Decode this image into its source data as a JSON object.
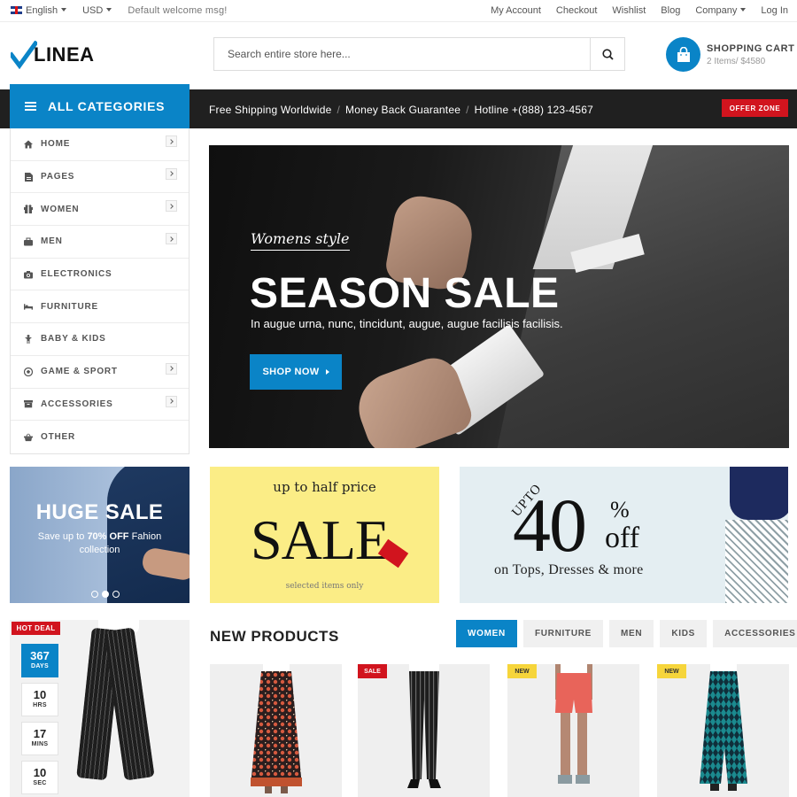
{
  "topbar": {
    "language": "English",
    "currency": "USD",
    "welcome": "Default welcome msg!",
    "links": [
      "My Account",
      "Checkout",
      "Wishlist",
      "Blog",
      "Company",
      "Log In"
    ]
  },
  "header": {
    "logo": "LINEA",
    "search_placeholder": "Search entire store here...",
    "cart_label": "SHOPPING CART",
    "cart_summary": "2 Items/ $4580"
  },
  "nav": {
    "all_categories": "ALL CATEGORIES",
    "promos": [
      "Free Shipping Worldwide",
      "Money Back Guarantee",
      "Hotline +(888) 123-4567"
    ],
    "promo_separator": "/",
    "offer_zone": "OFFER ZONE"
  },
  "categories": [
    {
      "label": "HOME",
      "icon": "home-icon",
      "submenu": true
    },
    {
      "label": "PAGES",
      "icon": "file-icon",
      "submenu": true
    },
    {
      "label": "WOMEN",
      "icon": "gift-icon",
      "submenu": true
    },
    {
      "label": "MEN",
      "icon": "briefcase-icon",
      "submenu": true
    },
    {
      "label": "ELECTRONICS",
      "icon": "camera-icon",
      "submenu": false
    },
    {
      "label": "FURNITURE",
      "icon": "bed-icon",
      "submenu": false
    },
    {
      "label": "BABY & KIDS",
      "icon": "child-icon",
      "submenu": false
    },
    {
      "label": "GAME & SPORT",
      "icon": "ball-icon",
      "submenu": true
    },
    {
      "label": "ACCESSORIES",
      "icon": "archive-icon",
      "submenu": true
    },
    {
      "label": "OTHER",
      "icon": "basket-icon",
      "submenu": false
    }
  ],
  "hero": {
    "subtitle": "Womens style",
    "title": "SEASON SALE",
    "description": "In augue urna, nunc, tincidunt, augue, augue facilisis facilisis.",
    "button": "SHOP NOW"
  },
  "banners": {
    "huge_sale": {
      "title": "HUGE SALE",
      "line1": "Save up to",
      "highlight": "70% OFF",
      "line1_rest": "Fahion",
      "line2": "collection"
    },
    "half_price": {
      "top": "up to half price",
      "big": "SALE",
      "small": "selected items only"
    },
    "forty_off": {
      "upto": "UPTO",
      "number": "40",
      "percent": "%",
      "off": "off",
      "sub": "on Tops, Dresses & more"
    }
  },
  "hot_deal": {
    "badge": "HOT DEAL",
    "countdown": [
      {
        "value": "367",
        "unit": "DAYS"
      },
      {
        "value": "10",
        "unit": "HRS"
      },
      {
        "value": "17",
        "unit": "MINS"
      },
      {
        "value": "10",
        "unit": "SEC"
      }
    ]
  },
  "new_products": {
    "title": "NEW PRODUCTS",
    "tabs": [
      "WOMEN",
      "FURNITURE",
      "MEN",
      "KIDS",
      "ACCESSORIES"
    ],
    "active_tab": "WOMEN",
    "items": [
      {
        "badge": ""
      },
      {
        "badge": "SALE"
      },
      {
        "badge": "NEW"
      },
      {
        "badge": "NEW"
      }
    ]
  },
  "colors": {
    "accent": "#0a84c7",
    "dark": "#202020",
    "red": "#d1141e",
    "yellow": "#f6d53b"
  }
}
